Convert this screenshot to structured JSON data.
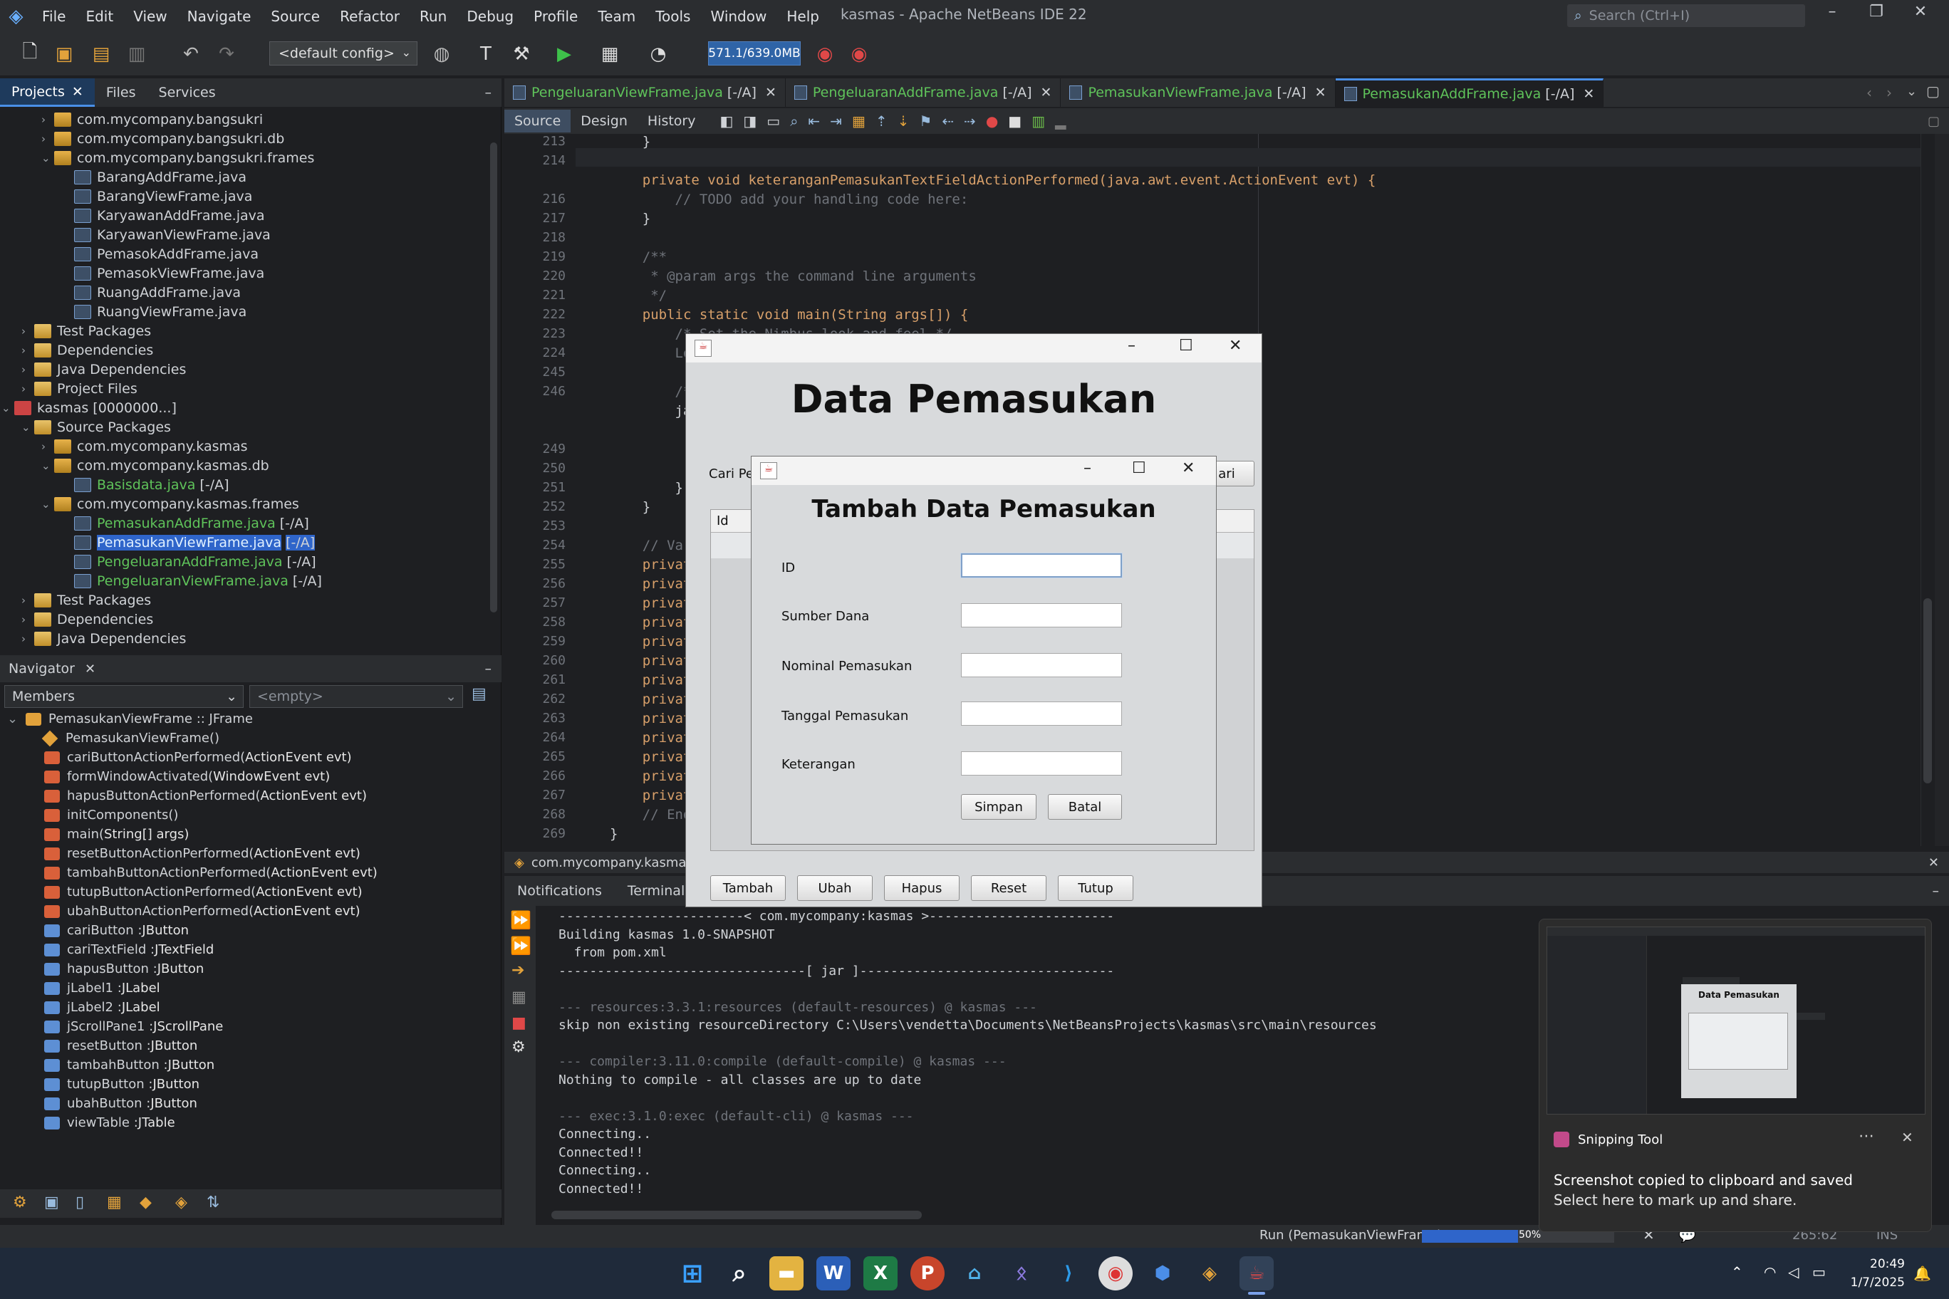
{
  "menu": [
    "File",
    "Edit",
    "View",
    "Navigate",
    "Source",
    "Refactor",
    "Run",
    "Debug",
    "Profile",
    "Team",
    "Tools",
    "Window",
    "Help"
  ],
  "window_title": "kasmas - Apache NetBeans IDE 22",
  "search_placeholder": "Search (Ctrl+I)",
  "config": "<default config>",
  "memory": "571.1/639.0MB",
  "panel_tabs": [
    "Projects",
    "Files",
    "Services"
  ],
  "tree": [
    {
      "label": "com.mycompany.bangsukri",
      "tw": "›",
      "icon": "pkg",
      "indent": 1
    },
    {
      "label": "com.mycompany.bangsukri.db",
      "tw": "›",
      "icon": "pkg",
      "indent": 1
    },
    {
      "label": "com.mycompany.bangsukri.frames",
      "tw": "⌄",
      "icon": "pkg",
      "indent": 1
    },
    {
      "label": "BarangAddFrame.java",
      "tw": "",
      "icon": "java",
      "indent": 2
    },
    {
      "label": "BarangViewFrame.java",
      "tw": "",
      "icon": "java",
      "indent": 2
    },
    {
      "label": "KaryawanAddFrame.java",
      "tw": "",
      "icon": "java",
      "indent": 2
    },
    {
      "label": "KaryawanViewFrame.java",
      "tw": "",
      "icon": "java",
      "indent": 2
    },
    {
      "label": "PemasokAddFrame.java",
      "tw": "",
      "icon": "java",
      "indent": 2
    },
    {
      "label": "PemasokViewFrame.java",
      "tw": "",
      "icon": "java",
      "indent": 2
    },
    {
      "label": "RuangAddFrame.java",
      "tw": "",
      "icon": "java",
      "indent": 2
    },
    {
      "label": "RuangViewFrame.java",
      "tw": "",
      "icon": "java",
      "indent": 2
    },
    {
      "label": "Test Packages",
      "tw": "›",
      "icon": "folder",
      "indent": 0
    },
    {
      "label": "Dependencies",
      "tw": "›",
      "icon": "folder",
      "indent": 0
    },
    {
      "label": "Java Dependencies",
      "tw": "›",
      "icon": "folder",
      "indent": 0
    },
    {
      "label": "Project Files",
      "tw": "›",
      "icon": "folder",
      "indent": 0
    },
    {
      "label": "kasmas [0000000...]",
      "tw": "⌄",
      "icon": "proj",
      "indent": -1
    },
    {
      "label": "Source Packages",
      "tw": "⌄",
      "icon": "folder",
      "indent": 0
    },
    {
      "label": "com.mycompany.kasmas",
      "tw": "›",
      "icon": "pkg",
      "indent": 1
    },
    {
      "label": "com.mycompany.kasmas.db",
      "tw": "⌄",
      "icon": "pkg",
      "indent": 1
    },
    {
      "label": "Basisdata.java",
      "tag": "[-/A]",
      "tw": "",
      "icon": "java",
      "indent": 2,
      "green": true
    },
    {
      "label": "com.mycompany.kasmas.frames",
      "tw": "⌄",
      "icon": "pkg",
      "indent": 1
    },
    {
      "label": "PemasukanAddFrame.java",
      "tag": "[-/A]",
      "tw": "",
      "icon": "java",
      "indent": 2,
      "green": true
    },
    {
      "label": "PemasukanViewFrame.java",
      "tag": "[-/A]",
      "tw": "",
      "icon": "java",
      "indent": 2,
      "green": true,
      "selected": true
    },
    {
      "label": "PengeluaranAddFrame.java",
      "tag": "[-/A]",
      "tw": "",
      "icon": "java",
      "indent": 2,
      "green": true
    },
    {
      "label": "PengeluaranViewFrame.java",
      "tag": "[-/A]",
      "tw": "",
      "icon": "java",
      "indent": 2,
      "green": true
    },
    {
      "label": "Test Packages",
      "tw": "›",
      "icon": "folder",
      "indent": 0
    },
    {
      "label": "Dependencies",
      "tw": "›",
      "icon": "folder",
      "indent": 0
    },
    {
      "label": "Java Dependencies",
      "tw": "›",
      "icon": "folder",
      "indent": 0
    }
  ],
  "navigator": {
    "title": "Navigator",
    "members": "Members",
    "empty": "<empty>",
    "root": "PemasukanViewFrame :: JFrame",
    "items": [
      {
        "name": "PemasukanViewFrame()",
        "type": "",
        "kind": "c"
      },
      {
        "name": "cariButtonActionPerformed(",
        "type": "ActionEvent evt)",
        "kind": "m"
      },
      {
        "name": "formWindowActivated(",
        "type": "WindowEvent evt)",
        "kind": "m"
      },
      {
        "name": "hapusButtonActionPerformed(",
        "type": "ActionEvent evt)",
        "kind": "m"
      },
      {
        "name": "initComponents()",
        "type": "",
        "kind": "m"
      },
      {
        "name": "main(",
        "type": "String[] args)",
        "kind": "m"
      },
      {
        "name": "resetButtonActionPerformed(",
        "type": "ActionEvent evt)",
        "kind": "m"
      },
      {
        "name": "tambahButtonActionPerformed(",
        "type": "ActionEvent evt)",
        "kind": "m"
      },
      {
        "name": "tutupButtonActionPerformed(",
        "type": "ActionEvent evt)",
        "kind": "m"
      },
      {
        "name": "ubahButtonActionPerformed(",
        "type": "ActionEvent evt)",
        "kind": "m"
      },
      {
        "name": "cariButton : ",
        "type": "JButton",
        "kind": "f"
      },
      {
        "name": "cariTextField : ",
        "type": "JTextField",
        "kind": "f"
      },
      {
        "name": "hapusButton : ",
        "type": "JButton",
        "kind": "f"
      },
      {
        "name": "jLabel1 : ",
        "type": "JLabel",
        "kind": "f"
      },
      {
        "name": "jLabel2 : ",
        "type": "JLabel",
        "kind": "f"
      },
      {
        "name": "jScrollPane1 : ",
        "type": "JScrollPane",
        "kind": "f"
      },
      {
        "name": "resetButton : ",
        "type": "JButton",
        "kind": "f"
      },
      {
        "name": "tambahButton : ",
        "type": "JButton",
        "kind": "f"
      },
      {
        "name": "tutupButton : ",
        "type": "JButton",
        "kind": "f"
      },
      {
        "name": "ubahButton : ",
        "type": "JButton",
        "kind": "f"
      },
      {
        "name": "viewTable : ",
        "type": "JTable",
        "kind": "f"
      }
    ]
  },
  "editor_tabs": [
    {
      "name": "PengeluaranViewFrame.java",
      "tag": "[-/A]"
    },
    {
      "name": "PengeluaranAddFrame.java",
      "tag": "[-/A]"
    },
    {
      "name": "PemasukanViewFrame.java",
      "tag": "[-/A]"
    },
    {
      "name": "PemasukanAddFrame.java",
      "tag": "[-/A]",
      "active": true
    }
  ],
  "editor_modes": [
    "Source",
    "Design",
    "History"
  ],
  "code_lines": [
    {
      "n": "213",
      "t": "    }",
      "cls": ""
    },
    {
      "n": "214",
      "t": "",
      "cls": ""
    },
    {
      "n": "",
      "t": "    private void keteranganPemasukanTextFieldActionPerformed(java.awt.event.ActionEvent evt) {",
      "cls": "m"
    },
    {
      "n": "216",
      "t": "        // TODO add your handling code here:",
      "cls": "cm"
    },
    {
      "n": "217",
      "t": "    }",
      "cls": ""
    },
    {
      "n": "218",
      "t": "",
      "cls": ""
    },
    {
      "n": "219",
      "t": "    /**",
      "cls": "cm"
    },
    {
      "n": "220",
      "t": "     * @param args the command line arguments",
      "cls": "cm"
    },
    {
      "n": "221",
      "t": "     */",
      "cls": "cm"
    },
    {
      "n": "222",
      "t": "    public static void main(String args[]) {",
      "cls": "main"
    },
    {
      "n": "223",
      "t": "        /* Set the Nimbus look and feel */",
      "cls": "cm"
    },
    {
      "n": "224",
      "t": "        Look",
      "cls": "cm"
    },
    {
      "n": "245",
      "t": "",
      "cls": ""
    },
    {
      "n": "246",
      "t": "        /* Cr",
      "cls": "cm"
    },
    {
      "n": "",
      "t": "        java.",
      "cls": ""
    },
    {
      "n": "",
      "t": "            p",
      "cls": ""
    },
    {
      "n": "249",
      "t": "",
      "cls": ""
    },
    {
      "n": "250",
      "t": "            }",
      "cls": ""
    },
    {
      "n": "251",
      "t": "        });",
      "cls": ""
    },
    {
      "n": "252",
      "t": "    }",
      "cls": ""
    },
    {
      "n": "253",
      "t": "",
      "cls": ""
    },
    {
      "n": "254",
      "t": "    // Variab",
      "cls": "cm"
    },
    {
      "n": "255",
      "t": "    private j",
      "cls": "p"
    },
    {
      "n": "256",
      "t": "    private j",
      "cls": "p"
    },
    {
      "n": "257",
      "t": "    private j",
      "cls": "p"
    },
    {
      "n": "258",
      "t": "    private j",
      "cls": "p"
    },
    {
      "n": "259",
      "t": "    private j",
      "cls": "p"
    },
    {
      "n": "260",
      "t": "    private j",
      "cls": "p"
    },
    {
      "n": "261",
      "t": "    private j",
      "cls": "p"
    },
    {
      "n": "262",
      "t": "    private j",
      "cls": "p"
    },
    {
      "n": "263",
      "t": "    private j",
      "cls": "p"
    },
    {
      "n": "264",
      "t": "    private j",
      "cls": "p"
    },
    {
      "n": "265",
      "t": "    private j",
      "cls": "p"
    },
    {
      "n": "266",
      "t": "    private j",
      "cls": "p"
    },
    {
      "n": "267",
      "t": "    private j",
      "cls": "p"
    },
    {
      "n": "268",
      "t": "    // End of",
      "cls": "cm"
    },
    {
      "n": "269",
      "t": "}",
      "cls": ""
    }
  ],
  "breadcrumb": "com.mycompany.kasmas.",
  "output_tabs": [
    "Notifications",
    "Terminal -"
  ],
  "output_lines": [
    {
      "t": "------------------------< com.mycompany:kasmas >------------------------",
      "dim": false
    },
    {
      "t": "Building kasmas 1.0-SNAPSHOT",
      "dim": false
    },
    {
      "t": "  from pom.xml",
      "dim": false
    },
    {
      "t": "--------------------------------[ jar ]---------------------------------",
      "dim": false
    },
    {
      "t": "",
      "dim": false
    },
    {
      "t": "--- resources:3.3.1:resources (default-resources) @ kasmas ---",
      "dim": true
    },
    {
      "t": "skip non existing resourceDirectory C:\\Users\\vendetta\\Documents\\NetBeansProjects\\kasmas\\src\\main\\resources",
      "dim": false
    },
    {
      "t": "",
      "dim": false
    },
    {
      "t": "--- compiler:3.11.0:compile (default-compile) @ kasmas ---",
      "dim": true
    },
    {
      "t": "Nothing to compile - all classes are up to date",
      "dim": false
    },
    {
      "t": "",
      "dim": false
    },
    {
      "t": "--- exec:3.1.0:exec (default-cli) @ kasmas ---",
      "dim": true
    },
    {
      "t": "Connecting..",
      "dim": false
    },
    {
      "t": "Connected!!",
      "dim": false
    },
    {
      "t": "Connecting..",
      "dim": false
    },
    {
      "t": "Connected!!",
      "dim": false
    }
  ],
  "status": {
    "run": "Run (PemasukanViewFrame)",
    "progress": "50%",
    "progress_value": 0.5,
    "pos": "265:62",
    "mode": "INS"
  },
  "view_frame": {
    "title": "Data Pemasukan",
    "search_label": "Cari Pe",
    "search_btn": "ari",
    "col_id": "Id",
    "buttons": [
      "Tambah",
      "Ubah",
      "Hapus",
      "Reset",
      "Tutup"
    ]
  },
  "add_frame": {
    "title": "Tambah Data Pemasukan",
    "fields": [
      "ID",
      "Sumber Dana",
      "Nominal Pemasukan",
      "Tanggal Pemasukan",
      "Keterangan"
    ],
    "save": "Simpan",
    "cancel": "Batal"
  },
  "toast": {
    "app": "Snipping Tool",
    "line1": "Screenshot copied to clipboard and saved",
    "line2": "Select here to mark up and share.",
    "thumb_title": "Data Pemasukan"
  },
  "clock": {
    "time": "20:49",
    "date": "1/7/2025"
  }
}
